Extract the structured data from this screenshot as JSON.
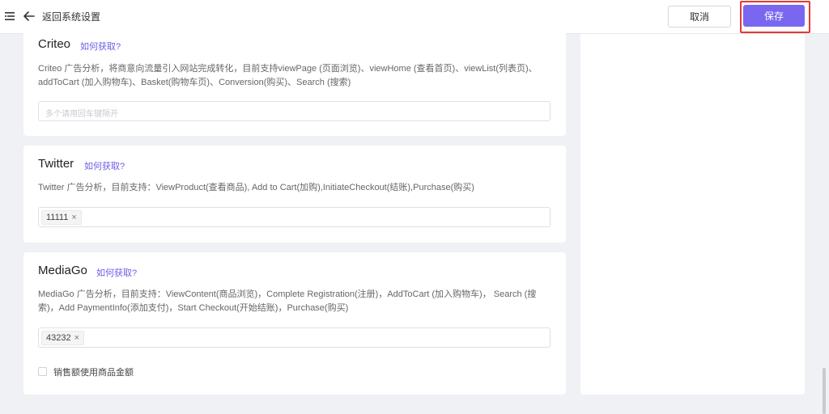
{
  "header": {
    "back_label": "返回系统设置",
    "cancel_label": "取消",
    "save_label": "保存"
  },
  "criteo": {
    "title": "Criteo",
    "link": "如何获取?",
    "desc_line1": "Criteo 广告分析，将商意向流量引入网站完成转化，目前支持viewPage (页面浏览)、viewHome (查看首页)、viewList(列表页)、",
    "desc_line2": "addToCart (加入购物车)、Basket(购物车页)、Conversion(购买)、Search (搜索)",
    "placeholder": "多个请用回车键隔开"
  },
  "twitter": {
    "title": "Twitter",
    "link": "如何获取?",
    "desc": "Twitter 广告分析，目前支持：ViewProduct(查看商品), Add to Cart(加购),InitiateCheckout(结账),Purchase(购买)",
    "tag": "11111"
  },
  "mediago": {
    "title": "MediaGo",
    "link": "如何获取?",
    "desc_line1": "MediaGo 广告分析，目前支持：ViewContent(商品浏览)，Complete Registration(注册)，AddToCart (加入购物车)， Search (搜",
    "desc_line2": "索)，Add PaymentInfo(添加支付)，Start Checkout(开始结账)，Purchase(购买)",
    "tag": "43232",
    "checkbox_label": "销售额使用商品金额"
  },
  "icons": {
    "tag_close": "×"
  }
}
